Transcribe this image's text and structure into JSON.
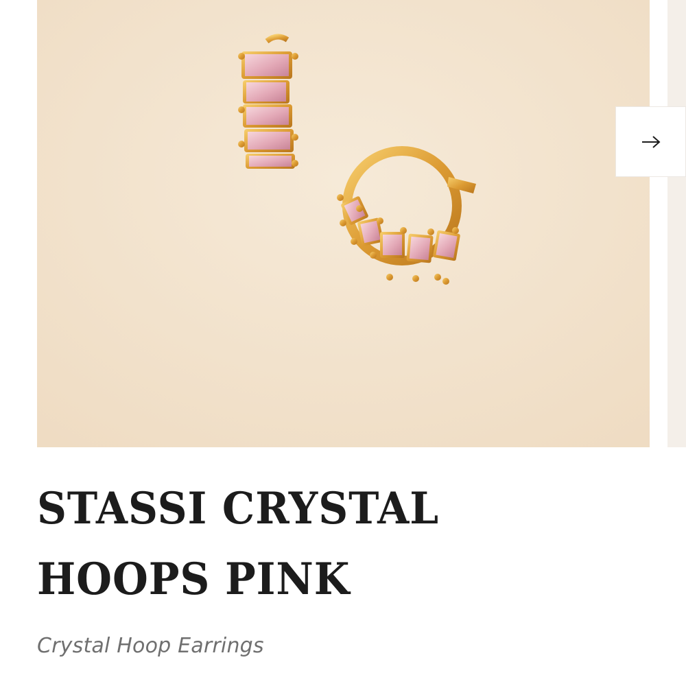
{
  "product": {
    "title": "STASSI CRYSTAL HOOPS PINK",
    "subtitle": "Crystal Hoop Earrings"
  },
  "gallery": {
    "next_icon": "arrow-right-icon",
    "image_subject": "pink-crystal-gold-hoop-earrings"
  },
  "colors": {
    "background": "#f3e6d3",
    "gold": "#e3a93f",
    "crystal": "#e9b9c4",
    "title": "#1c1c1c",
    "subtitle": "#6f6f6f"
  }
}
